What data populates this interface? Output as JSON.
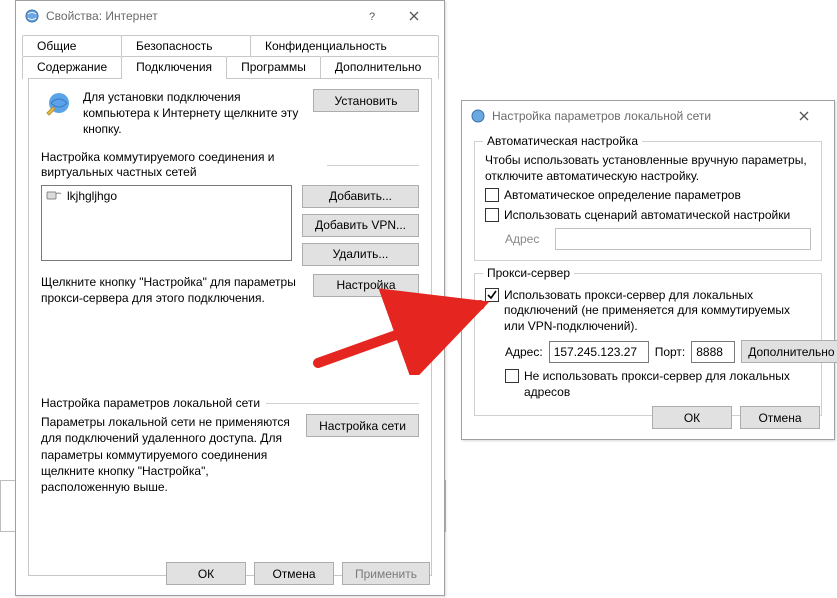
{
  "colors": {
    "arrow": "#e52620"
  },
  "win1": {
    "title": "Свойства: Интернет",
    "tabs_row1": [
      "Общие",
      "Безопасность",
      "Конфиденциальность"
    ],
    "tabs_row2": [
      "Содержание",
      "Подключения",
      "Программы",
      "Дополнительно"
    ],
    "active_tab": "Подключения",
    "setup_text": "Для установки подключения компьютера к Интернету щелкните эту кнопку.",
    "setup_button": "Установить",
    "dialup_section": "Настройка коммутируемого соединения и виртуальных частных сетей",
    "dialup_items": [
      "lkjhgljhgo"
    ],
    "add_button": "Добавить...",
    "add_vpn_button": "Добавить VPN...",
    "remove_button": "Удалить...",
    "settings_button": "Настройка",
    "settings_hint": "Щелкните кнопку \"Настройка\" для параметры прокси-сервера для этого подключения.",
    "lan_section": "Настройка параметров локальной сети",
    "lan_desc": "Параметры локальной сети не применяются для подключений удаленного доступа. Для параметры коммутируемого соединения щелкните кнопку \"Настройка\", расположенную выше.",
    "lan_button": "Настройка сети",
    "ok": "ОК",
    "cancel": "Отмена",
    "apply": "Применить"
  },
  "win2": {
    "title": "Настройка параметров локальной сети",
    "autocfg_legend": "Автоматическая настройка",
    "autocfg_desc": "Чтобы использовать установленные вручную параметры, отключите автоматическую настройку.",
    "autodetect_label": "Автоматическое определение параметров",
    "autodetect_checked": false,
    "script_label": "Использовать сценарий автоматической настройки",
    "script_checked": false,
    "address_label": "Адрес",
    "address_value": "",
    "proxy_legend": "Прокси-сервер",
    "use_proxy_label": "Использовать прокси-сервер для локальных подключений (не применяется для коммутируемых или VPN-подключений).",
    "use_proxy_checked": true,
    "addr_label": "Адрес:",
    "addr_value": "157.245.123.27",
    "port_label": "Порт:",
    "port_value": "8888",
    "advanced_button": "Дополнительно",
    "bypass_label": "Не использовать прокси-сервер для локальных адресов",
    "bypass_checked": false,
    "ok": "ОК",
    "cancel": "Отмена"
  }
}
